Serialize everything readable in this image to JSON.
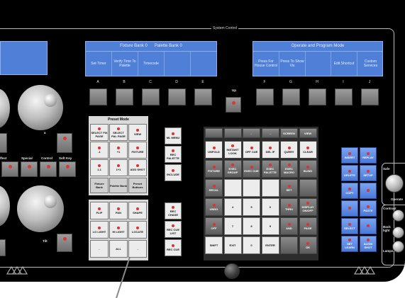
{
  "system_control_label": "System Control",
  "fixture_screen": {
    "header_left": "Fixture Bank 0",
    "header_right": "Palette Bank 0",
    "cells": [
      "Set Timer",
      "Verify Time To Palette",
      "Timecode",
      "",
      ""
    ],
    "letters": [
      "A",
      "B",
      "C",
      "D",
      "E"
    ]
  },
  "operate_screen": {
    "header": "Operate and Program Mode",
    "cells": [
      "Press For House Control",
      "Press To Show Vis",
      "",
      "Edit Shortcut",
      "Custom Services"
    ],
    "letters": [
      "F",
      "G",
      "H",
      "I",
      "J"
    ]
  },
  "up_label": "Up",
  "left_labels": {
    "effect": "ffect",
    "special": "Special",
    "control": "Control",
    "softkey": "Soft Key",
    "wheel_a": "a",
    "wheel_tilt": "Tilt"
  },
  "preset_mode": {
    "title": "Preset Mode",
    "rows": [
      [
        "SELECT FIX PAGE",
        "SELECT PAL PAGE",
        "VIEW"
      ],
      [
        "-1",
        "+1",
        "FIXTURE"
      ],
      [
        "1-1",
        "1+1",
        "ADD SHOT"
      ]
    ],
    "footer": [
      "Fixture Bank",
      "Palette Bank",
      "Preset Buttons"
    ]
  },
  "fx_keys": {
    "row1": [
      "FLIP",
      "PAN",
      "SHAPE"
    ],
    "row2": [
      "LO LIGHT",
      "HI LIGHT",
      "LOCATE"
    ],
    "row3": [
      "←",
      "ALL",
      "→"
    ],
    "group_label": "Group Fixture"
  },
  "menu_column": [
    "ML MENU",
    "REC PALETTE",
    "INCLUDE",
    "REC CHASE",
    "REC CUE LIST",
    "REC CUE"
  ],
  "keypad": {
    "top_row": [
      "",
      "",
      "←",
      "→",
      "SCREEN",
      "VIEW"
    ],
    "row1": [
      "UNFOLD",
      "INSTANT LOOK",
      "OFF CUE",
      "DEL IP",
      "QUERY",
      "CLEAR"
    ],
    "row2": [
      "FIXTURE",
      "EXEC GROUP",
      "EXEC CUE",
      "EXEC PALETTE",
      "EXEC MACRO",
      "BLIND"
    ],
    "row3": [
      "RECAL",
      "",
      "",
      "",
      "SET",
      ""
    ],
    "row4": [
      "UNDO",
      "4",
      "5",
      "6",
      "THRU",
      "DISPLAY ON/OFF"
    ],
    "row5": [
      "OFF",
      "7",
      "8",
      "9",
      "AND",
      "PAGE"
    ],
    "row6": [
      "SHIFT",
      "EXIT",
      "0",
      "ENTER",
      "",
      "OK"
    ]
  },
  "blue_keys": {
    "col1": [
      "INSERT",
      "DELETE",
      "COPY",
      "",
      "SELECT",
      "SET LEARN"
    ],
    "col2": [
      "REPLAY",
      "SETUP",
      "",
      "PASTE",
      "",
      "ALIGN SHOT"
    ]
  },
  "right_labels": {
    "safe": "Safe",
    "operate": "Operate",
    "contrast": "Contrast",
    "backlight": "Back light",
    "lamps": "Lamps"
  },
  "colors": {
    "console": "#000000",
    "screen": "#4f7fd6",
    "led": "#e03535",
    "blue_key": "#5a86e0",
    "white_key": "#ececec"
  }
}
